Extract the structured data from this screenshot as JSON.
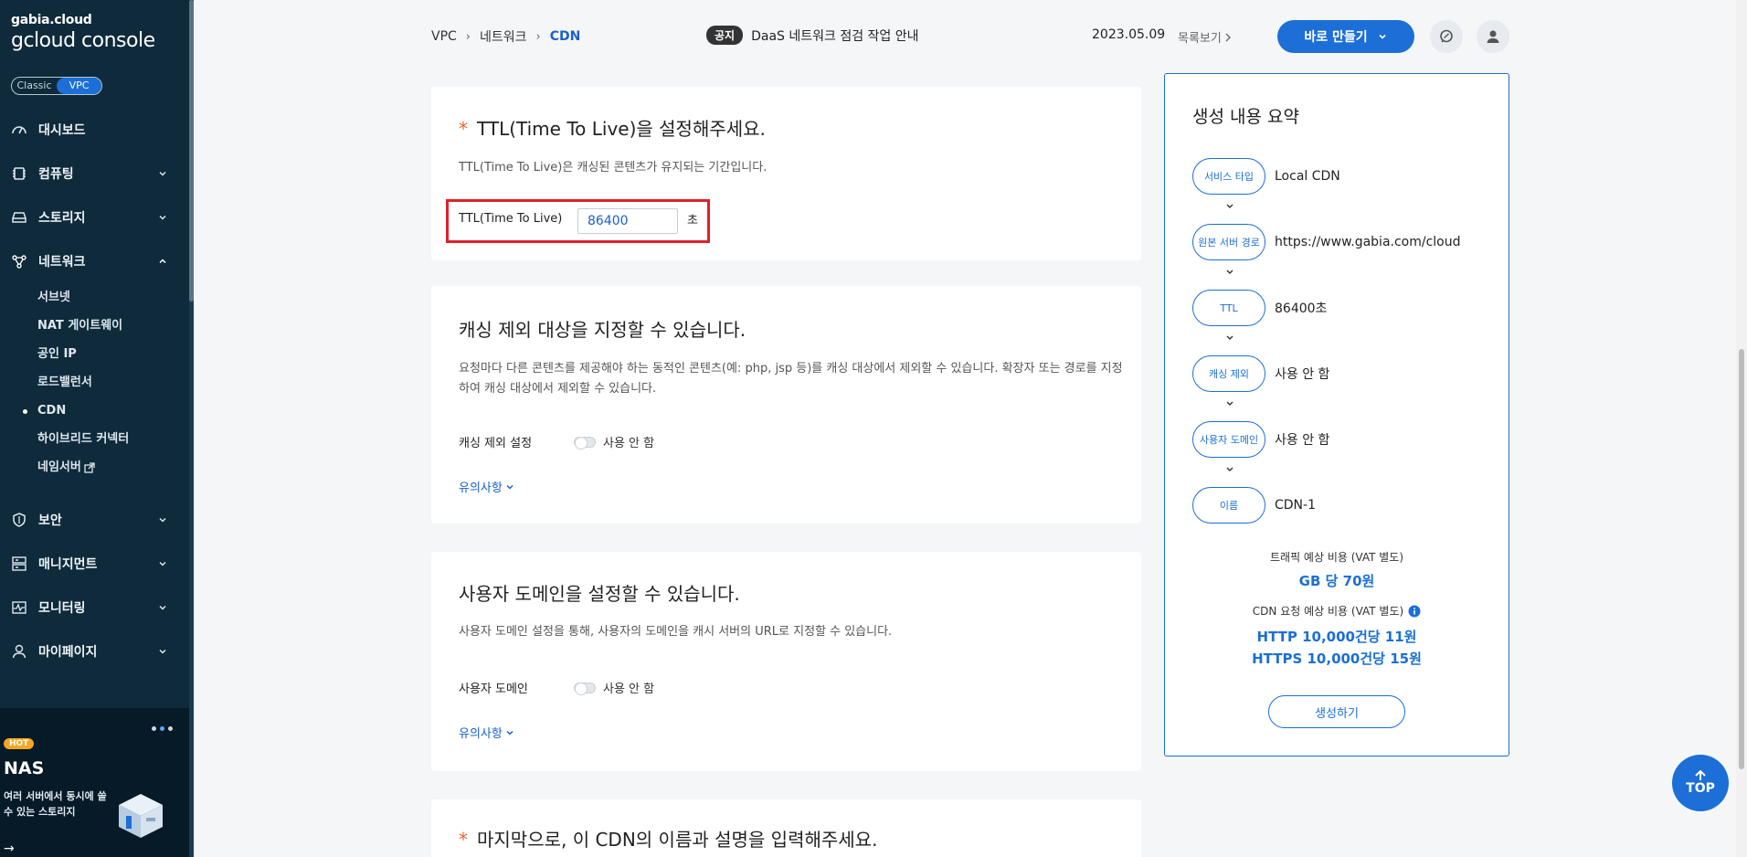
{
  "sidebar": {
    "logo_top": "gabia.cloud",
    "logo_bottom": "gcloud console",
    "mode_classic": "Classic",
    "mode_vpc": "VPC",
    "items": [
      {
        "label": "대시보드"
      },
      {
        "label": "컴퓨팅"
      },
      {
        "label": "스토리지"
      },
      {
        "label": "네트워크"
      },
      {
        "label": "보안"
      },
      {
        "label": "매니지먼트"
      },
      {
        "label": "모니터링"
      },
      {
        "label": "마이페이지"
      }
    ],
    "network_sub": [
      {
        "label": "서브넷"
      },
      {
        "label": "NAT 게이트웨이"
      },
      {
        "label": "공인 IP"
      },
      {
        "label": "로드밸런서"
      },
      {
        "label": "CDN"
      },
      {
        "label": "하이브리드 커넥터"
      },
      {
        "label": "네임서버"
      }
    ],
    "banner": {
      "hot": "HOT",
      "title": "NAS",
      "desc": "여러 서버에서 동시에 쓸 수 있는 스토리지",
      "arrow": "→"
    }
  },
  "header": {
    "breadcrumb": [
      "VPC",
      "네트워크",
      "CDN"
    ],
    "breadcrumb_sep": "›",
    "notice_badge": "공지",
    "notice_text": "DaaS 네트워크 점검 작업 안내",
    "date": "2023.05.09",
    "list_link": "목록보기",
    "make_button": "바로 만들기"
  },
  "ttl_section": {
    "required_mark": "*",
    "title": "TTL(Time To Live)을 설정해주세요.",
    "desc": "TTL(Time To Live)은 캐싱된 콘텐츠가 유지되는 기간입니다.",
    "field_label": "TTL(Time To Live)",
    "value": "86400",
    "unit": "초"
  },
  "cache_section": {
    "title": "캐싱 제외 대상을 지정할 수 있습니다.",
    "desc": "요청마다 다른 콘텐츠를 제공해야 하는 동적인 콘텐츠(예: php, jsp 등)를 캐싱 대상에서 제외할 수 있습니다. 확장자 또는 경로를 지정하여 캐싱 대상에서 제외할 수 있습니다.",
    "field_label": "캐싱 제외 설정",
    "toggle_text": "사용 안 함",
    "note": "유의사항"
  },
  "domain_section": {
    "title": "사용자 도메인을 설정할 수 있습니다.",
    "desc": "사용자 도메인 설정을 통해, 사용자의 도메인을 캐시 서버의 URL로 지정할 수 있습니다.",
    "field_label": "사용자 도메인",
    "toggle_text": "사용 안 함",
    "note": "유의사항"
  },
  "name_section": {
    "required_mark": "*",
    "title": "마지막으로, 이 CDN의 이름과 설명을 입력해주세요."
  },
  "summary": {
    "title": "생성 내용 요약",
    "steps": [
      {
        "label": "서비스 타입",
        "value": "Local CDN"
      },
      {
        "label": "원본 서버 경로",
        "value": "https://www.gabia.com/cloud"
      },
      {
        "label": "TTL",
        "value": "86400초"
      },
      {
        "label": "캐싱 제외",
        "value": "사용 안 함"
      },
      {
        "label": "사용자 도메인",
        "value": "사용 안 함"
      },
      {
        "label": "이름",
        "value": "CDN-1"
      }
    ],
    "traffic_label": "트래픽 예상 비용 (VAT 별도)",
    "traffic_value": "GB 당 70원",
    "request_label": "CDN 요청 예상 비용 (VAT 별도)",
    "request_http": "HTTP 10,000건당 11원",
    "request_https": "HTTPS 10,000건당 15원",
    "create_button": "생성하기"
  },
  "top_button": "TOP"
}
